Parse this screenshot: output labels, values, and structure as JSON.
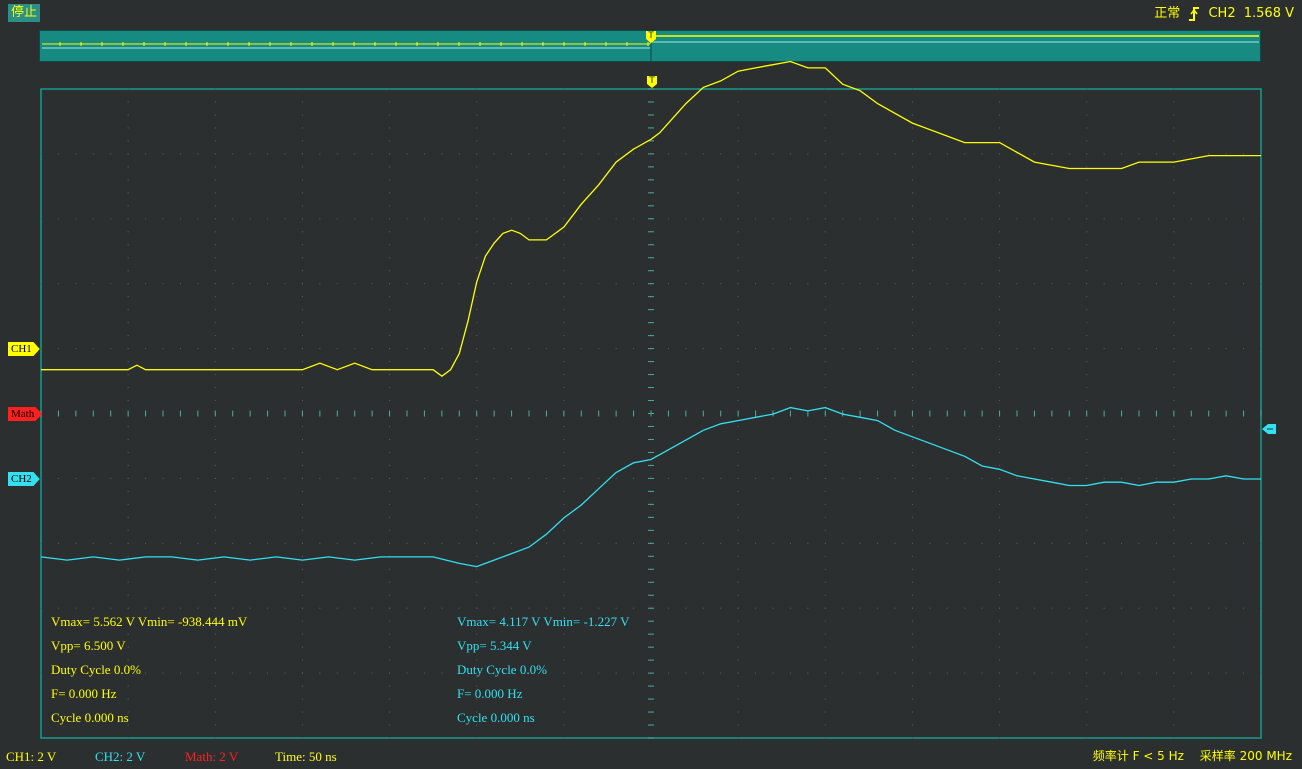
{
  "top_bar": {
    "run_state": "停止",
    "trigger_mode": "正常",
    "trigger_edge_icon": "rising-edge-icon",
    "trigger_source": "CH2",
    "trigger_level": "1.568 V"
  },
  "channels": {
    "ch1": {
      "label": "CH1",
      "color": "#ffff00"
    },
    "math": {
      "label": "Math",
      "color": "#ff2020"
    },
    "ch2": {
      "label": "CH2",
      "color": "#33e0f0"
    }
  },
  "trigger_marker": "T",
  "measurements": {
    "ch1": {
      "vmax_vmin": "Vmax= 5.562 V  Vmin= -938.444 mV",
      "vpp": "Vpp= 6.500 V",
      "duty": "Duty Cycle 0.0%",
      "freq": "F= 0.000 Hz",
      "cycle": "Cycle 0.000 ns"
    },
    "ch2": {
      "vmax_vmin": "Vmax= 4.117 V  Vmin= -1.227 V",
      "vpp": "Vpp= 5.344 V",
      "duty": "Duty Cycle 0.0%",
      "freq": "F= 0.000 Hz",
      "cycle": "Cycle 0.000 ns"
    }
  },
  "status_bar": {
    "ch1_scale": "CH1: 2 V",
    "ch2_scale": "CH2: 2 V",
    "math_scale": "Math: 2 V",
    "timebase": "Time: 50 ns",
    "freq_counter": "频率计 F < 5 Hz",
    "sample_rate": "采样率 200 MHz"
  },
  "chart_data": {
    "type": "line",
    "grid": true,
    "x_divisions": 14,
    "y_divisions": 10,
    "volts_per_div": 2,
    "time_per_div_ns": 50,
    "series": [
      {
        "name": "CH1",
        "color": "#ffff00",
        "x_div": [
          0,
          0.5,
          1,
          1.1,
          1.2,
          1.3,
          1.5,
          2,
          3,
          3.2,
          3.4,
          3.6,
          3.8,
          4,
          4.5,
          4.6,
          4.7,
          4.8,
          4.9,
          5,
          5.1,
          5.2,
          5.3,
          5.4,
          5.5,
          5.6,
          5.8,
          6,
          6.2,
          6.4,
          6.6,
          6.8,
          7,
          7.1,
          7.2,
          7.4,
          7.6,
          7.8,
          8,
          8.2,
          8.4,
          8.6,
          8.8,
          9,
          9.2,
          9.4,
          9.6,
          10,
          10.6,
          11,
          11.4,
          11.8,
          12,
          12.2,
          12.4,
          12.6,
          12.8,
          13,
          13.4,
          13.8,
          14
        ],
        "y_div": [
          -0.15,
          -0.15,
          -0.15,
          -0.08,
          -0.15,
          -0.15,
          -0.15,
          -0.15,
          -0.15,
          -0.05,
          -0.15,
          -0.05,
          -0.15,
          -0.15,
          -0.15,
          -0.25,
          -0.15,
          0.1,
          0.6,
          1.2,
          1.6,
          1.8,
          1.95,
          2.0,
          1.95,
          1.85,
          1.85,
          2.05,
          2.4,
          2.7,
          3.05,
          3.25,
          3.4,
          3.5,
          3.65,
          3.95,
          4.2,
          4.3,
          4.45,
          4.5,
          4.55,
          4.6,
          4.5,
          4.5,
          4.25,
          4.15,
          3.95,
          3.65,
          3.35,
          3.35,
          3.05,
          2.95,
          2.95,
          2.95,
          2.95,
          3.05,
          3.05,
          3.05,
          3.15,
          3.15,
          3.15
        ]
      },
      {
        "name": "CH2",
        "color": "#33e0f0",
        "x_div": [
          0,
          0.3,
          0.6,
          0.9,
          1.2,
          1.5,
          1.8,
          2.1,
          2.4,
          2.7,
          3,
          3.3,
          3.6,
          3.9,
          4.2,
          4.5,
          4.8,
          5.0,
          5.2,
          5.4,
          5.6,
          5.8,
          6.0,
          6.2,
          6.4,
          6.6,
          6.8,
          7.0,
          7.2,
          7.4,
          7.6,
          7.8,
          8.0,
          8.2,
          8.4,
          8.6,
          8.8,
          9.0,
          9.2,
          9.4,
          9.6,
          9.8,
          10.0,
          10.2,
          10.4,
          10.6,
          10.8,
          11.0,
          11.2,
          11.4,
          11.6,
          11.8,
          12.0,
          12.2,
          12.4,
          12.6,
          12.8,
          13.0,
          13.2,
          13.4,
          13.6,
          13.8,
          14.0
        ],
        "y_div": [
          -1.2,
          -1.25,
          -1.2,
          -1.25,
          -1.2,
          -1.2,
          -1.25,
          -1.2,
          -1.25,
          -1.2,
          -1.25,
          -1.2,
          -1.25,
          -1.2,
          -1.2,
          -1.2,
          -1.3,
          -1.35,
          -1.25,
          -1.15,
          -1.05,
          -0.85,
          -0.6,
          -0.4,
          -0.15,
          0.1,
          0.25,
          0.3,
          0.45,
          0.6,
          0.75,
          0.85,
          0.9,
          0.95,
          1.0,
          1.1,
          1.05,
          1.1,
          1.0,
          0.95,
          0.9,
          0.75,
          0.65,
          0.55,
          0.45,
          0.35,
          0.2,
          0.15,
          0.05,
          0.0,
          -0.05,
          -0.1,
          -0.1,
          -0.05,
          -0.05,
          -0.1,
          -0.05,
          -0.05,
          0.0,
          0.0,
          0.05,
          0.0,
          0.0
        ]
      }
    ]
  }
}
